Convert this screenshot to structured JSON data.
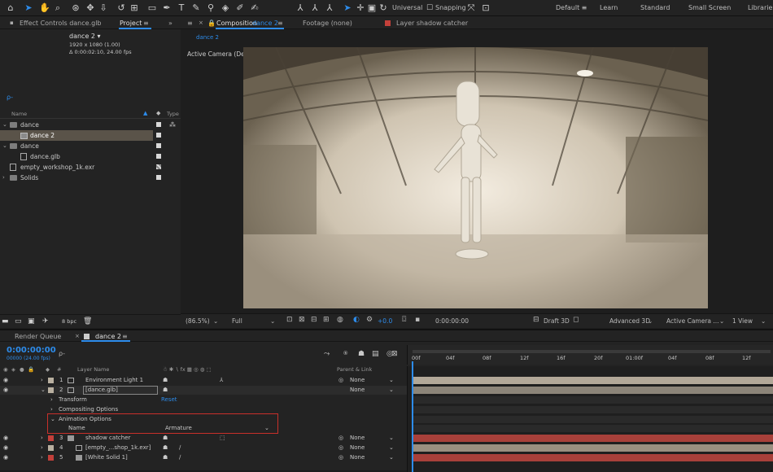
{
  "workspaces": [
    "Default",
    "Learn",
    "Standard",
    "Small Screen",
    "Librarie"
  ],
  "toolbar": {
    "universal": "Universal",
    "snapping": "Snapping"
  },
  "project_panel": {
    "tabs": [
      "Effect Controls dance.glb",
      "Project"
    ],
    "comp_name": "dance 2 ▾",
    "comp_res": "1920 x 1080 (1.00)",
    "comp_dur": "Δ 0:00:02:10, 24.00 fps",
    "search_glyph": "ρ-",
    "col_name": "Name",
    "col_type": "Type",
    "items": [
      {
        "label": "dance",
        "indent": 0
      },
      {
        "label": "dance 2",
        "indent": 1
      },
      {
        "label": "dance",
        "indent": 0
      },
      {
        "label": "dance.glb",
        "indent": 1
      },
      {
        "label": "empty_workshop_1k.exr",
        "indent": 0
      },
      {
        "label": "Solids",
        "indent": 0
      }
    ],
    "bpc": "8 bpc"
  },
  "viewer": {
    "tab_comp": "Composition",
    "tab_comp_name": "dance 2",
    "tab_footage": "Footage (none)",
    "tab_layer": "Layer shadow catcher",
    "breadcrumb": "dance 2",
    "camera_label": "Active Camera (Default)"
  },
  "viewbar": {
    "zoom": "(86.5%)",
    "quality": "Full",
    "exposure": "+0.0",
    "time": "0:00:00:00",
    "renderer": "Draft 3D",
    "renderer2": "Advanced 3D",
    "camera": "Active Camera ...",
    "views": "1 View"
  },
  "timeline": {
    "tabs": [
      "Render Queue",
      "dance 2"
    ],
    "timecode": "0:00:00:00",
    "timecode_sub": "00000 (24.00 fps)",
    "col_layer_name": "Layer Name",
    "col_parent": "Parent & Link",
    "ruler": [
      "00f",
      "04f",
      "08f",
      "12f",
      "16f",
      "20f",
      "01:00f",
      "04f",
      "08f",
      "12f"
    ],
    "layers": [
      {
        "num": "1",
        "name": "Environment Light 1",
        "parent": "None"
      },
      {
        "num": "2",
        "name": "[dance.glb]",
        "parent": "None"
      },
      {
        "num": "3",
        "name": "shadow catcher",
        "parent": "None"
      },
      {
        "num": "4",
        "name": "[empty_...shop_1k.exr]",
        "parent": "None"
      },
      {
        "num": "5",
        "name": "[White Solid 1]",
        "parent": "None"
      }
    ],
    "props": {
      "transform": "Transform",
      "reset": "Reset",
      "compositing": "Compositing Options",
      "animation": "Animation Options",
      "name_label": "Name",
      "armature": "Armature"
    }
  }
}
